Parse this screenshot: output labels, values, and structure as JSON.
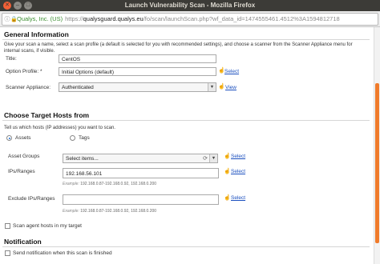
{
  "window": {
    "title": "Launch Vulnerability Scan - Mozilla Firefox"
  },
  "urlbar": {
    "site_identity": "Qualys, Inc. (US)",
    "scheme": "https://",
    "host": "qualysguard.qualys.eu",
    "path": "/fo/scan/launchScan.php?wf_data_id=1474555461.4512%3A1594812718"
  },
  "general": {
    "heading": "General Information",
    "description": "Give your scan a name, select a scan profile (a default is selected for you with recommended settings), and choose a scanner from the Scanner Appliance menu for internal scans, if visible.",
    "title_label": "Title:",
    "title_value": "CentOS",
    "option_label": "Option Profile: *",
    "option_value": "Initial Options (default)",
    "option_link": "Select",
    "scanner_label": "Scanner Appliance:",
    "scanner_value": "Authenticated",
    "scanner_link": "View"
  },
  "targets": {
    "heading": "Choose Target Hosts from",
    "description": "Tell us which hosts (IP addresses) you want to scan.",
    "radio_assets": "Assets",
    "radio_tags": "Tags",
    "selected_radio": "Assets",
    "asset_groups_label": "Asset Groups",
    "asset_groups_placeholder": "Select items...",
    "asset_groups_link": "Select",
    "ips_label": "IPs/Ranges",
    "ips_value": "192.168.56.101",
    "ips_link": "Select",
    "ips_example_label": "Example:",
    "ips_example": "192.168.0.87-192.168.0.92, 192.168.0.200",
    "exclude_label": "Exclude IPs/Ranges",
    "exclude_value": "",
    "exclude_link": "Select",
    "exclude_example_label": "Example:",
    "exclude_example": "192.168.0.87-192.168.0.92, 192.168.0.200",
    "scan_agent_label": "Scan agent hosts in my target"
  },
  "notification": {
    "heading": "Notification",
    "send_label": "Send notification when this scan is finished"
  },
  "colors": {
    "accent": "#f07b2b",
    "link": "#1a4fbf",
    "titlebar": "#3c3b37"
  },
  "icons": {
    "window_close": "close-icon",
    "lock": "lock-icon",
    "select_cursor": "hand-cursor-icon",
    "view": "view-icon",
    "loading": "spinner-icon"
  }
}
